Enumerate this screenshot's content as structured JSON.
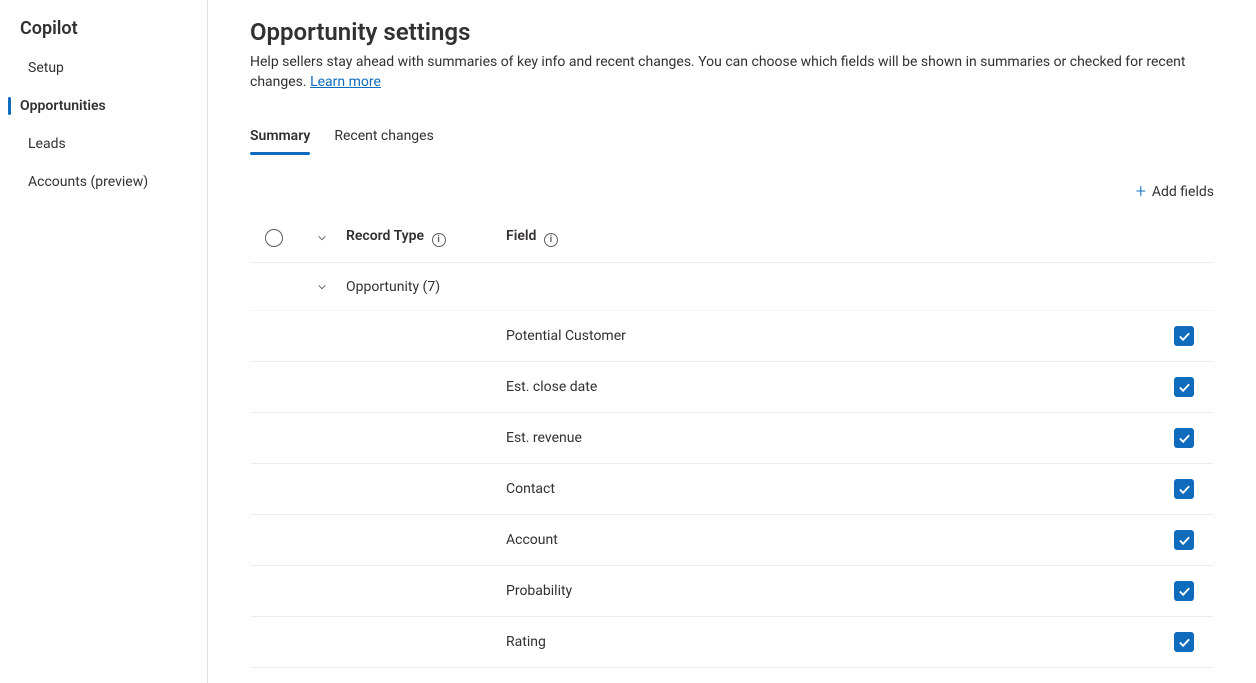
{
  "sidebar": {
    "title": "Copilot",
    "items": [
      {
        "label": "Setup",
        "active": false
      },
      {
        "label": "Opportunities",
        "active": true
      },
      {
        "label": "Leads",
        "active": false
      },
      {
        "label": "Accounts (preview)",
        "active": false
      }
    ]
  },
  "page": {
    "title": "Opportunity settings",
    "description": "Help sellers stay ahead with summaries of key info and recent changes. You can choose which fields will be shown in summaries or checked for recent changes. ",
    "learn_more": "Learn more"
  },
  "tabs": [
    {
      "label": "Summary",
      "active": true
    },
    {
      "label": "Recent changes",
      "active": false
    }
  ],
  "toolbar": {
    "add_fields": "Add fields"
  },
  "table": {
    "headers": {
      "record_type": "Record Type",
      "field": "Field"
    },
    "group": {
      "label": "Opportunity (7)"
    },
    "rows": [
      {
        "field": "Potential Customer",
        "checked": true
      },
      {
        "field": "Est. close date",
        "checked": true
      },
      {
        "field": "Est. revenue",
        "checked": true
      },
      {
        "field": "Contact",
        "checked": true
      },
      {
        "field": "Account",
        "checked": true
      },
      {
        "field": "Probability",
        "checked": true
      },
      {
        "field": "Rating",
        "checked": true
      }
    ]
  }
}
